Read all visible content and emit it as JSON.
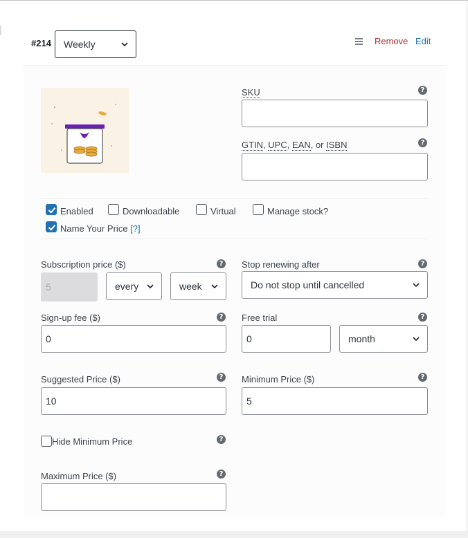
{
  "variation": {
    "id": "#214",
    "attribute_value": "Weekly",
    "remove_label": "Remove",
    "edit_label": "Edit",
    "icons": {
      "drag": "menu-icon",
      "dropdown": "chevron-down-icon"
    }
  },
  "image": {
    "icon": "coin-jar-image"
  },
  "sku": {
    "label": "SKU",
    "value": ""
  },
  "gtin": {
    "label_parts": [
      "GTIN",
      "UPC",
      "EAN",
      "ISBN"
    ],
    "sep1": ", ",
    "sep2": ", ",
    "sep3": ", or ",
    "value": ""
  },
  "options": {
    "enabled": {
      "label": "Enabled",
      "checked": true
    },
    "downloadable": {
      "label": "Downloadable",
      "checked": false
    },
    "virtual": {
      "label": "Virtual",
      "checked": false
    },
    "manage_stock": {
      "label": "Manage stock?",
      "checked": false
    },
    "name_your_price": {
      "label": "Name Your Price",
      "help": "[?]",
      "checked": true
    }
  },
  "subscription_price": {
    "label": "Subscription price ($)",
    "value": "5",
    "interval": "every",
    "period": "week"
  },
  "stop_renewing": {
    "label": "Stop renewing after",
    "value": "Do not stop until cancelled"
  },
  "signup_fee": {
    "label": "Sign-up fee ($)",
    "value": "0"
  },
  "free_trial": {
    "label": "Free trial",
    "value": "0",
    "period": "month"
  },
  "suggested_price": {
    "label": "Suggested Price ($)",
    "value": "10"
  },
  "minimum_price": {
    "label": "Minimum Price ($)",
    "value": "5"
  },
  "hide_minimum": {
    "label": "Hide Minimum Price",
    "checked": false
  },
  "maximum_price": {
    "label": "Maximum Price ($)",
    "value": ""
  },
  "help_icon": "?",
  "colors": {
    "accent": "#2271b1",
    "danger": "#b32d2e",
    "border": "#8c8f94"
  }
}
